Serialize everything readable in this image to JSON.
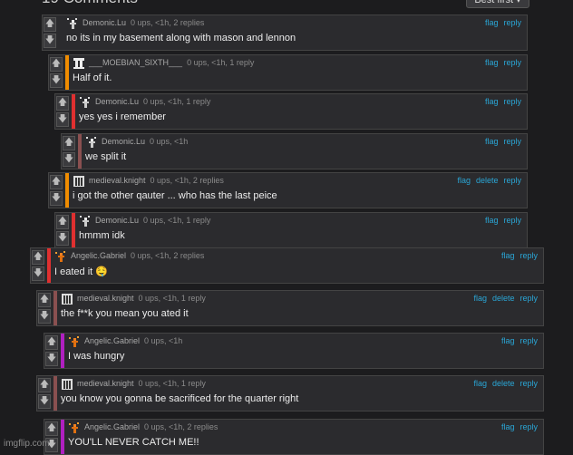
{
  "header": {
    "title": "19 Comments",
    "sort_label": "Best first ▾"
  },
  "vote": {
    "up_label": "🡅",
    "down_label": "🡇"
  },
  "comments": [
    {
      "user": "Demonic.Lu",
      "meta": "0 ups, <1h, 2 replies",
      "text": "no its in my basement along with mason and lennon",
      "actions": [
        "flag",
        "reply"
      ],
      "bar_color": "#2b2b2e",
      "avatar": "demonic-avatar"
    },
    {
      "user": "___MOEBIAN_SIXTH___",
      "meta": "0 ups, <1h, 1 reply",
      "text": "Half of it.",
      "actions": [
        "flag",
        "reply"
      ],
      "bar_color": "#f08c00",
      "avatar": "moebian-avatar"
    },
    {
      "user": "Demonic.Lu",
      "meta": "0 ups, <1h, 1 reply",
      "text": "yes yes i remember",
      "actions": [
        "flag",
        "reply"
      ],
      "bar_color": "#e03030",
      "avatar": "demonic-avatar"
    },
    {
      "user": "Demonic.Lu",
      "meta": "0 ups, <1h",
      "text": "we split it",
      "actions": [
        "flag",
        "reply"
      ],
      "bar_color": "#8a5050",
      "avatar": "demonic-avatar"
    },
    {
      "user": "medieval.knight",
      "meta": "0 ups, <1h, 2 replies",
      "text": "i got the other qauter ... who has the last peice",
      "actions": [
        "flag",
        "delete",
        "reply"
      ],
      "bar_color": "#f08c00",
      "avatar": "knight-avatar"
    },
    {
      "user": "Demonic.Lu",
      "meta": "0 ups, <1h, 1 reply",
      "text": "hmmm idk",
      "actions": [
        "flag",
        "reply"
      ],
      "bar_color": "#e03030",
      "avatar": "demonic-avatar"
    },
    {
      "user": "Angelic.Gabriel",
      "meta": "0 ups, <1h, 2 replies",
      "text": "I eated it 🤤",
      "actions": [
        "flag",
        "reply"
      ],
      "bar_color": "#e03030",
      "avatar": "angelic-avatar"
    },
    {
      "user": "medieval.knight",
      "meta": "0 ups, <1h, 1 reply",
      "text": "the f**k you mean you ated it",
      "actions": [
        "flag",
        "delete",
        "reply"
      ],
      "bar_color": "#8a5050",
      "avatar": "knight-avatar"
    },
    {
      "user": "Angelic.Gabriel",
      "meta": "0 ups, <1h",
      "text": "I was hungry",
      "actions": [
        "flag",
        "reply"
      ],
      "bar_color": "#b020c0",
      "avatar": "angelic-avatar"
    },
    {
      "user": "medieval.knight",
      "meta": "0 ups, <1h, 1 reply",
      "text": "you know you gonna be sacrificed for the quarter right",
      "actions": [
        "flag",
        "delete",
        "reply"
      ],
      "bar_color": "#8a5050",
      "avatar": "knight-avatar"
    },
    {
      "user": "Angelic.Gabriel",
      "meta": "0 ups, <1h, 2 replies",
      "text": "YOU'LL NEVER CATCH ME!!",
      "actions": [
        "flag",
        "reply"
      ],
      "bar_color": "#b020c0",
      "avatar": "angelic-avatar"
    }
  ],
  "watermark": "imgflip.com"
}
